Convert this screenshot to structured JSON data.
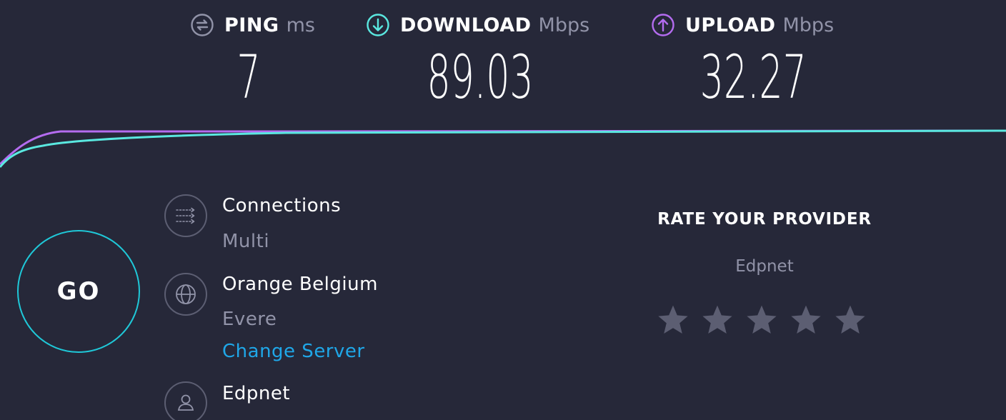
{
  "metrics": {
    "ping": {
      "label": "PING",
      "unit": "ms",
      "value": "7",
      "icon": "ping-icon"
    },
    "download": {
      "label": "DOWNLOAD",
      "unit": "Mbps",
      "value": "89.03",
      "icon": "download-arrow-icon",
      "color": "#5ae8e0"
    },
    "upload": {
      "label": "UPLOAD",
      "unit": "Mbps",
      "value": "32.27",
      "icon": "upload-arrow-icon",
      "color": "#b46cf0"
    }
  },
  "go_button": {
    "label": "GO",
    "color": "#1fc8d8"
  },
  "connections": {
    "title": "Connections",
    "value": "Multi",
    "icon": "connections-icon"
  },
  "server": {
    "name": "Orange Belgium",
    "location": "Evere",
    "change_label": "Change Server",
    "icon": "globe-icon"
  },
  "provider": {
    "name": "Edpnet",
    "icon": "user-icon"
  },
  "rating": {
    "title": "RATE YOUR PROVIDER",
    "provider": "Edpnet",
    "stars_total": 5,
    "stars_selected": 0
  },
  "colors": {
    "background": "#262839",
    "download_line": "#5ae8e0",
    "upload_line": "#b46cf0",
    "link": "#1fa7e8",
    "muted_text": "#9193a8"
  }
}
